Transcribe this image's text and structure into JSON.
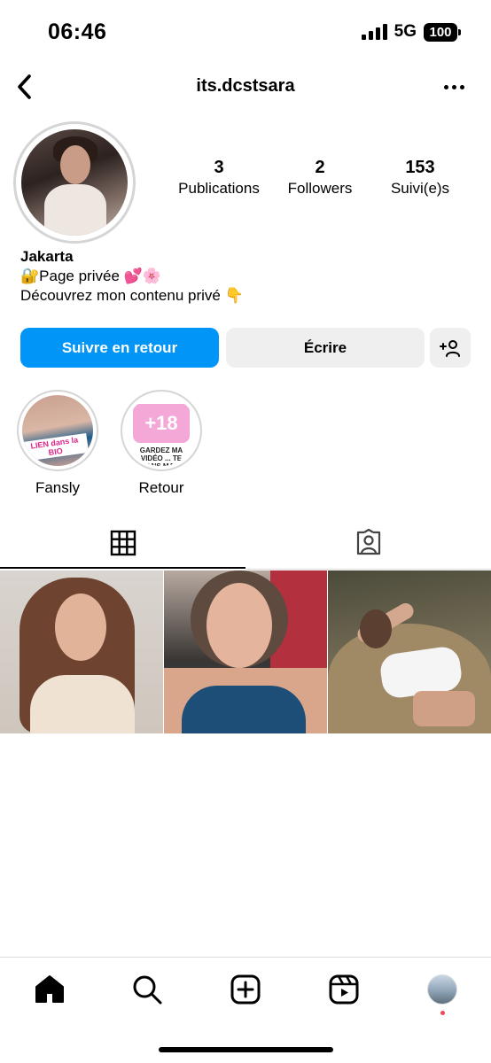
{
  "status_bar": {
    "time": "06:46",
    "network": "5G",
    "battery": "100"
  },
  "header": {
    "username": "its.dcstsara"
  },
  "stats": {
    "posts": {
      "count": "3",
      "label": "Publications"
    },
    "followers": {
      "count": "2",
      "label": "Followers"
    },
    "following": {
      "count": "153",
      "label": "Suivi(e)s"
    }
  },
  "bio": {
    "name": "Jakarta",
    "line1": "🔐Page privée 💕🌸",
    "line2": "Découvrez mon contenu privé 👇"
  },
  "actions": {
    "follow_label": "Suivre en retour",
    "message_label": "Écrire"
  },
  "highlights": [
    {
      "label": "Fansly",
      "tag_text": "LIEN dans la BIO"
    },
    {
      "label": "Retour",
      "badge": "+18",
      "caption": "GARDEZ MA VIDÉO ... TE DANS MA ..."
    }
  ],
  "tabs": {
    "grid_icon": "grid-icon",
    "tagged_icon": "tagged-icon"
  },
  "nav": {
    "home_icon": "home-icon",
    "search_icon": "search-icon",
    "create_icon": "create-icon",
    "reels_icon": "reels-icon",
    "profile_icon": "profile-avatar"
  },
  "colors": {
    "primary": "#0095f6",
    "secondary_button": "#efefef",
    "notification_dot": "#ed4956"
  }
}
